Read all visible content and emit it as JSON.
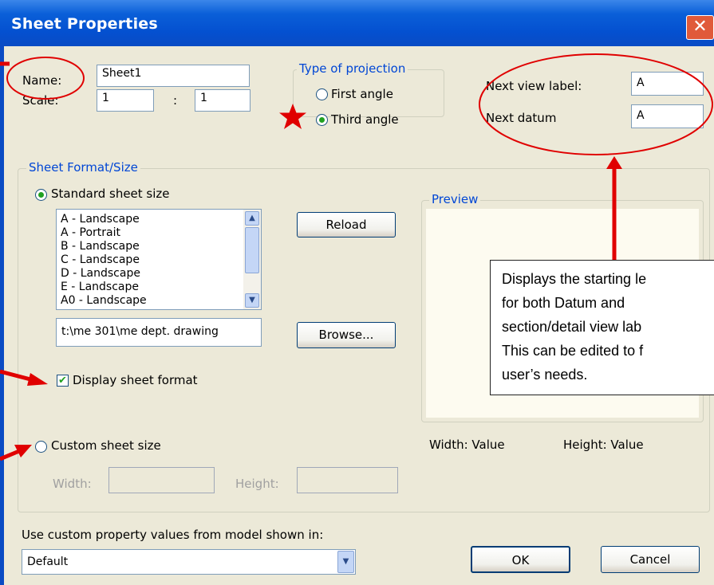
{
  "window": {
    "title": "Sheet Properties",
    "close_glyph": "✕"
  },
  "general": {
    "name_label": "Name:",
    "name_value": "Sheet1",
    "scale_label": "Scale:",
    "scale_num": "1",
    "scale_sep": ":",
    "scale_den": "1"
  },
  "projection": {
    "group_label": "Type of projection",
    "first_angle": "First angle",
    "third_angle": "Third angle",
    "selected": "third"
  },
  "labels": {
    "next_view_label": "Next view label:",
    "next_view_value": "A",
    "next_datum_label": "Next datum",
    "next_datum_value": "A"
  },
  "sheet_format": {
    "group_label": "Sheet Format/Size",
    "standard_label": "Standard sheet size",
    "sizes": [
      "A - Landscape",
      "A - Portrait",
      "B - Landscape",
      "C - Landscape",
      "D - Landscape",
      "E - Landscape",
      "A0 - Landscape"
    ],
    "reload_label": "Reload",
    "path_value": "t:\\me 301\\me dept. drawing",
    "browse_label": "Browse...",
    "display_format_label": "Display sheet format",
    "display_format_checked": true,
    "custom_label": "Custom sheet size",
    "width_label": "Width:",
    "height_label": "Height:"
  },
  "preview": {
    "group_label": "Preview",
    "width_text": "Width: Value",
    "height_text": "Height: Value"
  },
  "annotation": {
    "lines": [
      "Displays the starting le",
      "for both Datum and",
      "section/detail view lab",
      "This can be edited to f",
      "user’s needs."
    ]
  },
  "footer": {
    "custom_prop_label": "Use custom property values from model shown in:",
    "model_value": "Default",
    "ok_label": "OK",
    "cancel_label": "Cancel"
  },
  "colors": {
    "titlebar": "#0a5fd8",
    "annotation_red": "#e00000",
    "group_label": "#0046d5"
  }
}
